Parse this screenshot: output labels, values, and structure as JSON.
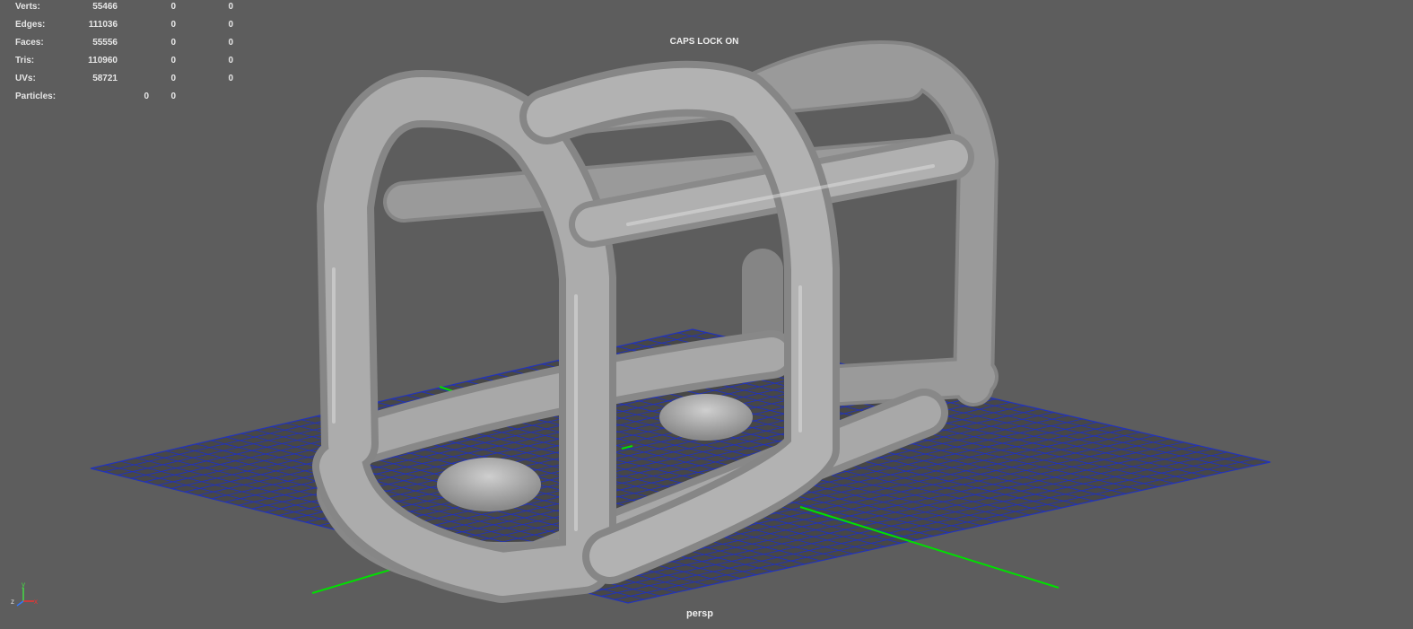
{
  "hud": {
    "rows": [
      {
        "label": "Verts:",
        "values": [
          "55466",
          "0",
          "0"
        ]
      },
      {
        "label": "Edges:",
        "values": [
          "111036",
          "0",
          "0"
        ]
      },
      {
        "label": "Faces:",
        "values": [
          "55556",
          "0",
          "0"
        ]
      },
      {
        "label": "Tris:",
        "values": [
          "110960",
          "0",
          "0"
        ]
      },
      {
        "label": "UVs:",
        "values": [
          "58721",
          "0",
          "0"
        ]
      },
      {
        "label": "Particles:",
        "values": [
          "0",
          "0"
        ]
      }
    ]
  },
  "overlay": {
    "caps_lock": "CAPS LOCK ON",
    "camera": "persp"
  },
  "axis_labels": {
    "x": "x",
    "y": "y",
    "z": "z"
  },
  "colors": {
    "background": "#5d5d5d",
    "grid_fill": "#474747",
    "grid_lines": "#2233bb",
    "grid_axis": "#00e000",
    "mesh": "#a4a4a4",
    "hud_text": "#e6e6e6"
  }
}
